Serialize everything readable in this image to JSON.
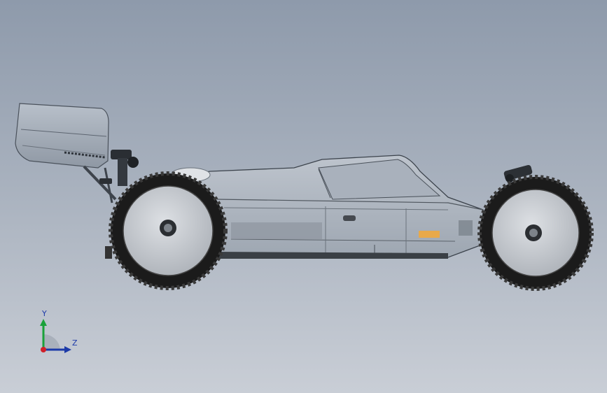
{
  "triad": {
    "y_label": "Y",
    "z_label": "Z"
  },
  "colors": {
    "background_top": "#8e9aab",
    "background_bottom": "#c9ced6",
    "y_axis": "#1aa13a",
    "z_axis": "#1c3aa8",
    "x_axis": "#d0202a",
    "tire": "#1b1b1b",
    "rim": "#c9cdd2",
    "body_shell": "#b9c0ca"
  },
  "icons": {
    "triad": "coordinate-triad-icon",
    "model": "rc-buggy-side-view"
  }
}
